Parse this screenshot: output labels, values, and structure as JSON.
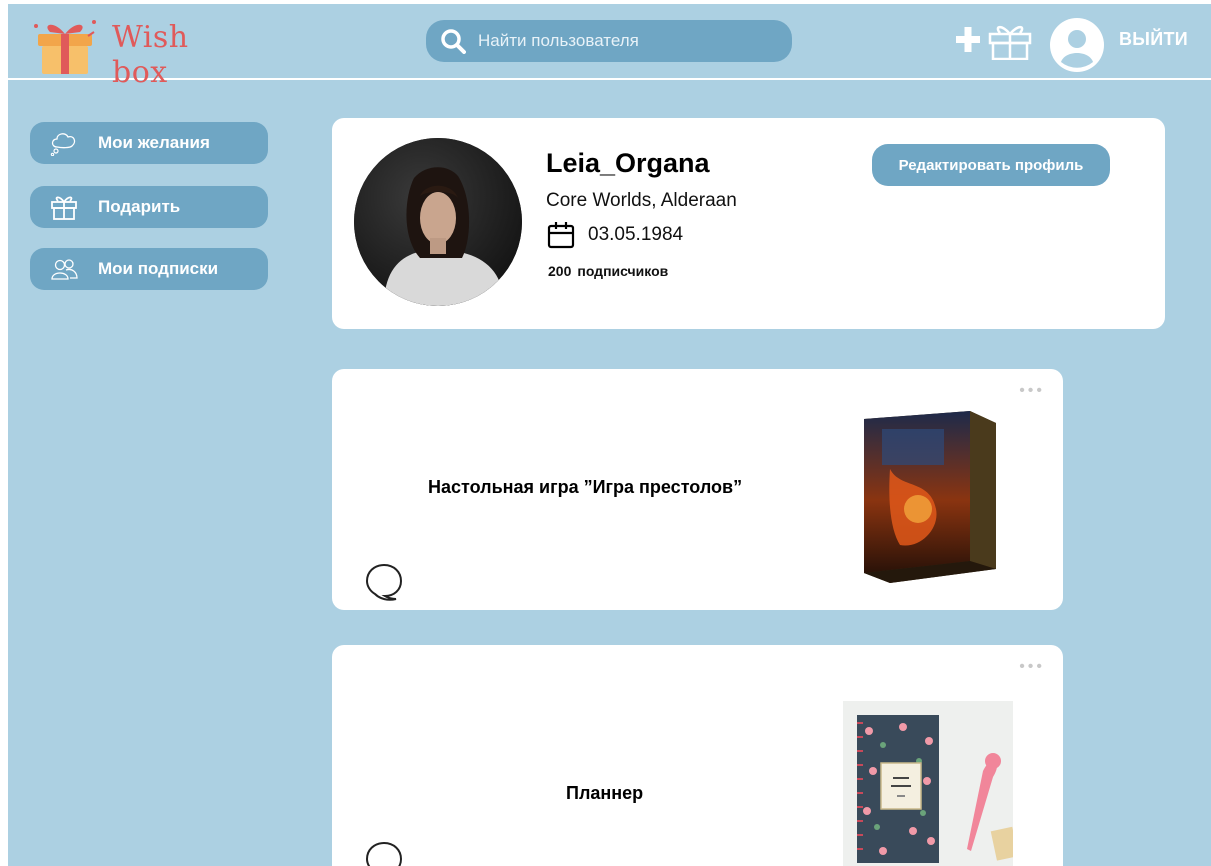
{
  "header": {
    "logo_text": "Wish box",
    "search_placeholder": "Найти пользователя",
    "logout_label": "ВЫЙТИ"
  },
  "sidebar": {
    "items": [
      {
        "label": "Мои желания",
        "icon": "cloud-icon"
      },
      {
        "label": "Подарить",
        "icon": "gift-icon"
      },
      {
        "label": "Мои подписки",
        "icon": "users-icon"
      }
    ]
  },
  "profile": {
    "username": "Leia_Organa",
    "location": "Core Worlds, Alderaan",
    "birthdate": "03.05.1984",
    "subscribers_count": "200",
    "subscribers_label": "подписчиков",
    "edit_label": "Редактировать профиль"
  },
  "wishes": [
    {
      "title": "Настольная игра ”Игра престолов”",
      "image": "board-game-box"
    },
    {
      "title": "Планнер",
      "image": "daily-planner"
    }
  ],
  "colors": {
    "background": "#acd0e2",
    "accent": "#6fa6c4",
    "logo": "#e05a5a",
    "card": "#ffffff"
  }
}
